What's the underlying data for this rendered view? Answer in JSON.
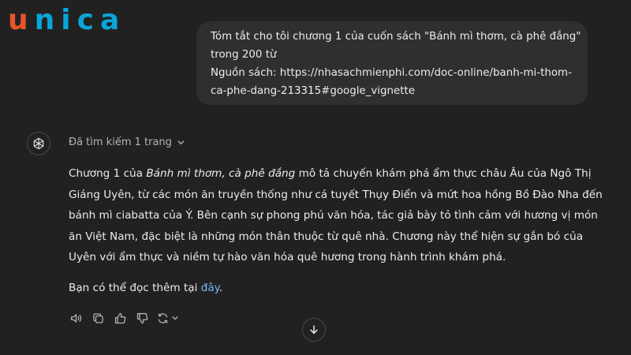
{
  "brand": {
    "letters": [
      "u",
      "n",
      "i",
      "c",
      "a"
    ],
    "colors": [
      "#e8552a",
      "#0aa5d8",
      "#0aa5d8",
      "#0aa5d8",
      "#0aa5d8"
    ]
  },
  "user_message": {
    "lines": [
      "Tóm tắt cho tôi chương 1 của cuốn sách \"Bánh mì thơm, cà phê đắng\"",
      "trong 200 từ",
      "Nguồn sách: https://nhasachmienphi.com/doc-online/banh-mi-thom-",
      "ca-phe-dang-213315#google_vignette"
    ]
  },
  "assistant": {
    "search_status": "Đã tìm kiếm 1 trang",
    "paragraph": {
      "line1_prefix": "Chương 1 của ",
      "line1_italic": "Bánh mì thơm, cà phê đắng",
      "line1_suffix": " mô tả chuyến khám phá ẩm thực châu Âu của Ngô Thị",
      "lines": [
        "Giáng Uyên, từ các món ăn truyền thống như cá tuyết Thụy Điển và mứt hoa hồng Bồ Đào Nha đến",
        "bánh mì ciabatta của Ý. Bên cạnh sự phong phú văn hóa, tác giả bày tỏ tình cảm với hương vị món",
        "ăn Việt Nam, đặc biệt là những món thân thuộc từ quê nhà. Chương này thể hiện sự gắn bó của",
        "Uyên với ẩm thực và niềm tự hào văn hóa quê hương trong hành trình khám phá."
      ]
    },
    "read_more_prefix": "Bạn có thể đọc thêm tại ",
    "read_more_link": "đây",
    "read_more_suffix": "."
  },
  "icons": {
    "avatar": "openai-logo-icon",
    "chevron": "chevron-down-icon",
    "actions": [
      "speaker-icon",
      "copy-icon",
      "thumbs-up-icon",
      "thumbs-down-icon",
      "regenerate-icon"
    ],
    "scroll": "arrow-down-icon"
  },
  "colors": {
    "background": "#212121",
    "bubble": "#2f2f2f",
    "link": "#7ab7ff",
    "muted": "#b4b4b4"
  }
}
